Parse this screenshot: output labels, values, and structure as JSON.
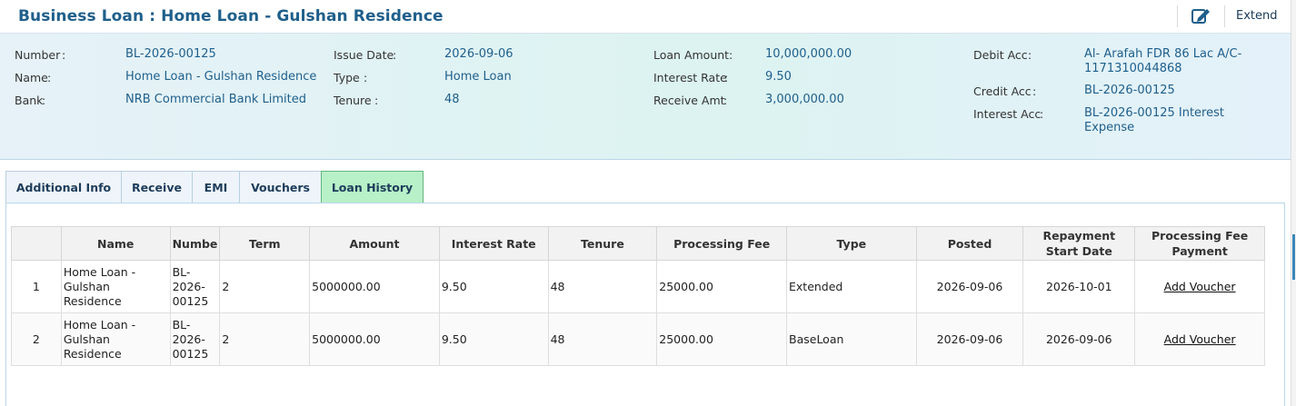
{
  "header": {
    "title": "Business Loan : Home Loan - Gulshan Residence",
    "edit_icon": "edit-icon",
    "extend_label": "Extend"
  },
  "info": {
    "number_label": "Number",
    "number_value": "BL-2026-00125",
    "name_label": "Name",
    "name_value": "Home Loan - Gulshan Residence",
    "bank_label": "Bank",
    "bank_value": "NRB Commercial Bank Limited",
    "issue_date_label": "Issue Date",
    "issue_date_value": "2026-09-06",
    "type_label": "Type",
    "type_value": "Home Loan",
    "tenure_label": "Tenure",
    "tenure_value": "48",
    "loan_amount_label": "Loan Amount",
    "loan_amount_value": "10,000,000.00",
    "interest_rate_label": "Interest Rate",
    "interest_rate_value": "9.50",
    "receive_amt_label": "Receive Amt",
    "receive_amt_value": "3,000,000.00",
    "debit_acc_label": "Debit Acc",
    "debit_acc_value_line1": "Al- Arafah FDR 86 Lac A/C-",
    "debit_acc_value_line2": "1171310044868",
    "credit_acc_label": "Credit Acc",
    "credit_acc_value": "BL-2026-00125",
    "interest_acc_label": "Interest Acc",
    "interest_acc_value_line1": "BL-2026-00125 Interest",
    "interest_acc_value_line2": "Expense",
    "colon": ":"
  },
  "tabs": [
    {
      "label": "Additional Info"
    },
    {
      "label": "Receive"
    },
    {
      "label": "EMI"
    },
    {
      "label": "Vouchers"
    },
    {
      "label": "Loan History",
      "active": true
    }
  ],
  "table": {
    "columns": [
      {
        "label": ""
      },
      {
        "label": "Name"
      },
      {
        "label": "Numbe"
      },
      {
        "label": "Term"
      },
      {
        "label": "Amount"
      },
      {
        "label": "Interest Rate"
      },
      {
        "label": "Tenure"
      },
      {
        "label": "Processing Fee"
      },
      {
        "label": "Type"
      },
      {
        "label": "Posted"
      },
      {
        "label": "Repayment Start Date"
      },
      {
        "label": "Processing Fee Payment"
      }
    ],
    "rows": [
      {
        "index": "1",
        "name_line1": "Home Loan -",
        "name_line2": "Gulshan Residence",
        "number_line1": "BL-",
        "number_line2": "2026-",
        "number_line3": "00125",
        "term": "2",
        "amount": "5000000.00",
        "interest_rate": "9.50",
        "tenure": "48",
        "processing_fee": "25000.00",
        "type": "Extended",
        "posted": "2026-09-06",
        "repayment_start": "2026-10-01",
        "action": "Add Voucher"
      },
      {
        "index": "2",
        "name_line1": "Home Loan -",
        "name_line2": "Gulshan Residence",
        "number_line1": "BL-",
        "number_line2": "2026-",
        "number_line3": "00125",
        "term": "2",
        "amount": "5000000.00",
        "interest_rate": "9.50",
        "tenure": "48",
        "processing_fee": "25000.00",
        "type": "BaseLoan",
        "posted": "2026-09-06",
        "repayment_start": "2026-09-06",
        "action": "Add Voucher"
      }
    ]
  },
  "colors": {
    "title": "#1f5f8b",
    "active_tab": "#b8f0c8",
    "value_text": "#1f5f8b"
  }
}
